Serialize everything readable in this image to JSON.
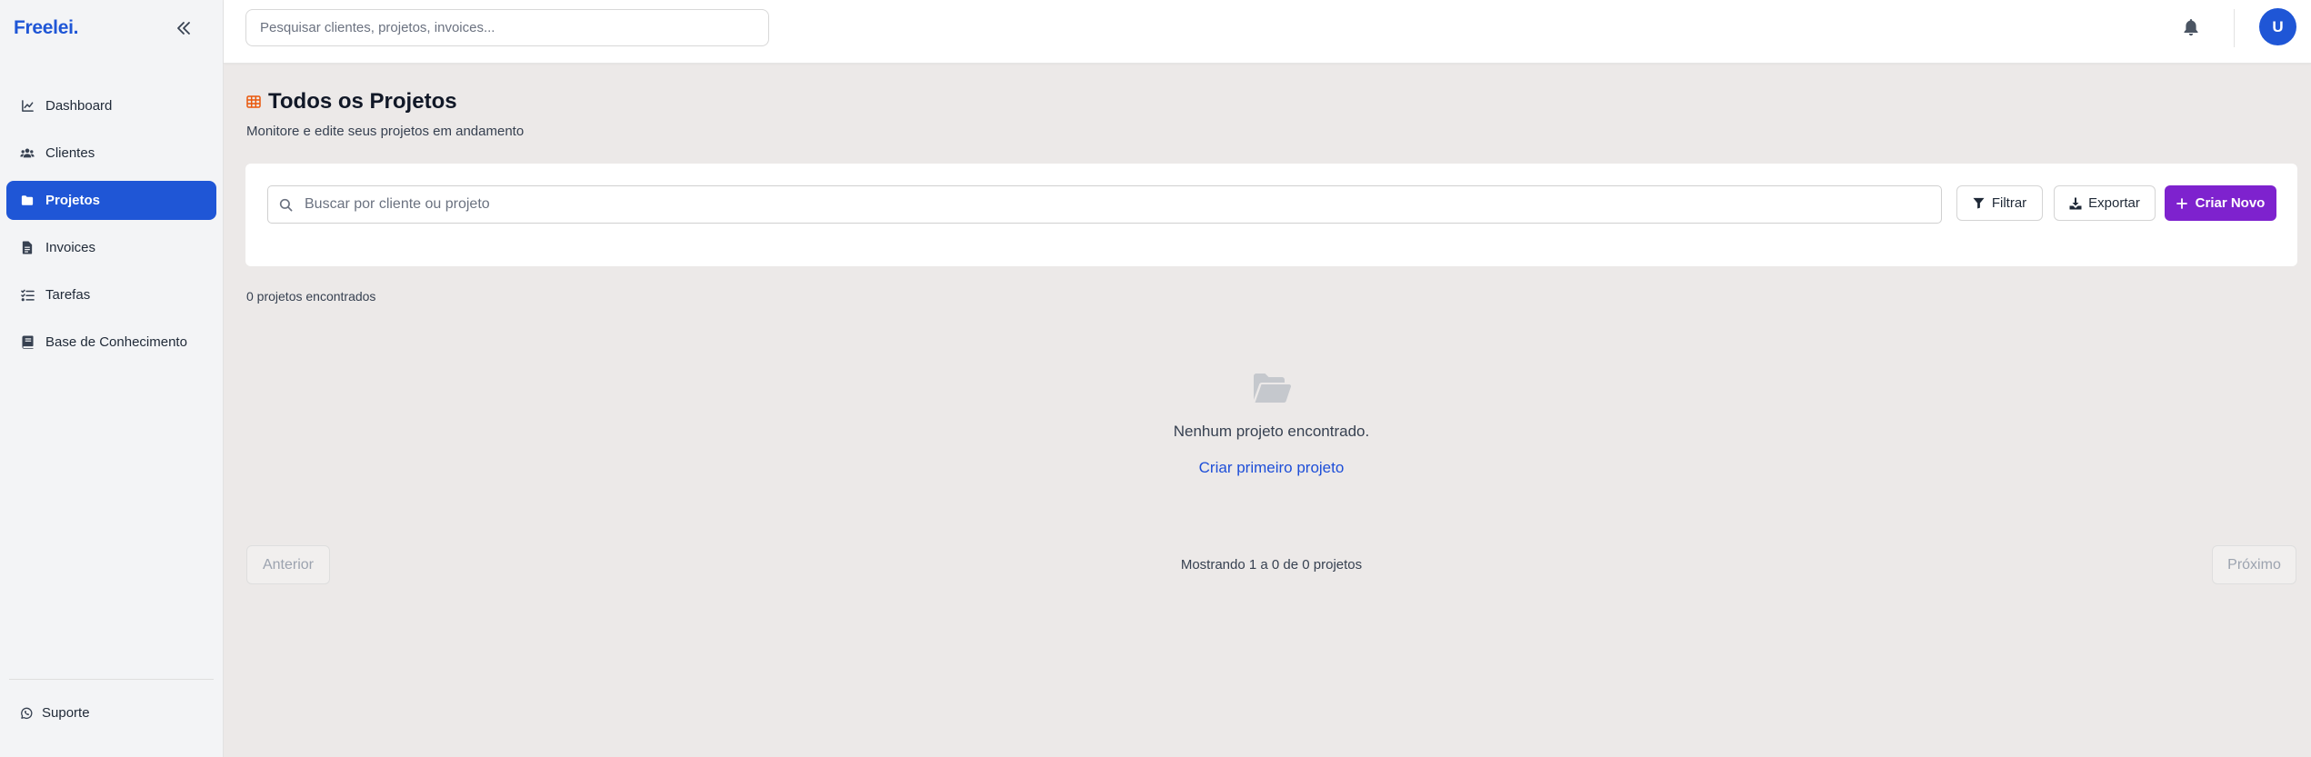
{
  "brand": {
    "name": "Freelei."
  },
  "sidebar": {
    "items": [
      {
        "label": "Dashboard",
        "icon": "chart-line-icon"
      },
      {
        "label": "Clientes",
        "icon": "users-icon"
      },
      {
        "label": "Projetos",
        "icon": "folder-icon",
        "active": true
      },
      {
        "label": "Invoices",
        "icon": "document-icon"
      },
      {
        "label": "Tarefas",
        "icon": "list-check-icon"
      },
      {
        "label": "Base de Conhecimento",
        "icon": "book-icon"
      }
    ],
    "support": {
      "label": "Suporte",
      "icon": "whatsapp-icon"
    }
  },
  "topbar": {
    "search_placeholder": "Pesquisar clientes, projetos, invoices...",
    "avatar_initial": "U"
  },
  "page": {
    "title": "Todos os Projetos",
    "subtitle": "Monitore e edite seus projetos em andamento"
  },
  "toolbar": {
    "search_placeholder": "Buscar por cliente ou projeto",
    "filter_label": "Filtrar",
    "export_label": "Exportar",
    "create_label": "Criar Novo"
  },
  "results": {
    "count_text": "0 projetos encontrados"
  },
  "empty_state": {
    "message": "Nenhum projeto encontrado.",
    "link": "Criar primeiro projeto"
  },
  "pagination": {
    "prev_label": "Anterior",
    "next_label": "Próximo",
    "info": "Mostrando 1 a 0 de 0 projetos"
  },
  "colors": {
    "primary": "#1f56d6",
    "create_button": "#7e22ce",
    "title_icon": "#ea580c",
    "background": "#ece9e8"
  }
}
